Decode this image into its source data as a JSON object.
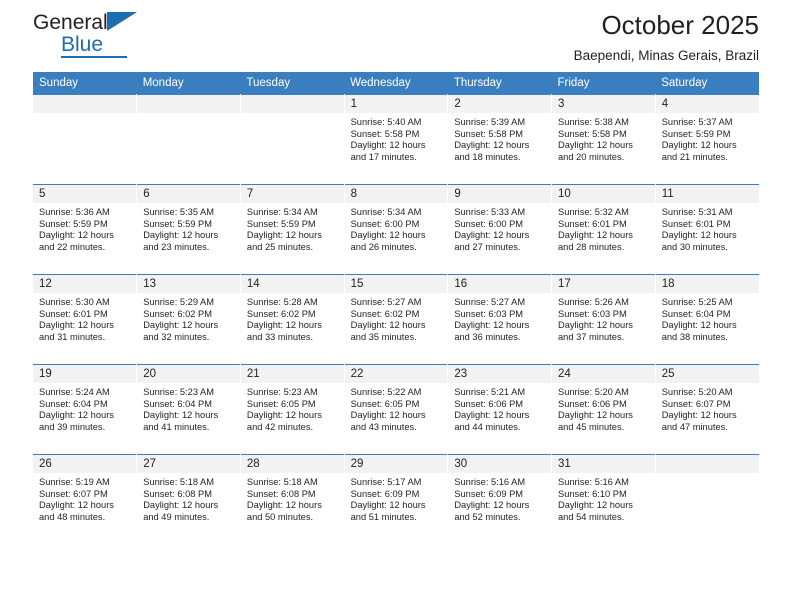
{
  "logo": {
    "word1": "General",
    "word2": "Blue",
    "triangle_color": "#1f6cb4",
    "icon": "general-blue-logo"
  },
  "header": {
    "title": "October 2025",
    "subtitle": "Baependi, Minas Gerais, Brazil"
  },
  "colors": {
    "header_blue": "#3a7ebf",
    "daynum_gray": "#f2f2f2",
    "text": "#231f20"
  },
  "weekdays": [
    "Sunday",
    "Monday",
    "Tuesday",
    "Wednesday",
    "Thursday",
    "Friday",
    "Saturday"
  ],
  "weeks": [
    [
      {
        "day": "",
        "empty": true
      },
      {
        "day": "",
        "empty": true
      },
      {
        "day": "",
        "empty": true
      },
      {
        "day": "1",
        "sunrise": "Sunrise: 5:40 AM",
        "sunset": "Sunset: 5:58 PM",
        "daylight1": "Daylight: 12 hours",
        "daylight2": "and 17 minutes."
      },
      {
        "day": "2",
        "sunrise": "Sunrise: 5:39 AM",
        "sunset": "Sunset: 5:58 PM",
        "daylight1": "Daylight: 12 hours",
        "daylight2": "and 18 minutes."
      },
      {
        "day": "3",
        "sunrise": "Sunrise: 5:38 AM",
        "sunset": "Sunset: 5:58 PM",
        "daylight1": "Daylight: 12 hours",
        "daylight2": "and 20 minutes."
      },
      {
        "day": "4",
        "sunrise": "Sunrise: 5:37 AM",
        "sunset": "Sunset: 5:59 PM",
        "daylight1": "Daylight: 12 hours",
        "daylight2": "and 21 minutes."
      }
    ],
    [
      {
        "day": "5",
        "sunrise": "Sunrise: 5:36 AM",
        "sunset": "Sunset: 5:59 PM",
        "daylight1": "Daylight: 12 hours",
        "daylight2": "and 22 minutes."
      },
      {
        "day": "6",
        "sunrise": "Sunrise: 5:35 AM",
        "sunset": "Sunset: 5:59 PM",
        "daylight1": "Daylight: 12 hours",
        "daylight2": "and 23 minutes."
      },
      {
        "day": "7",
        "sunrise": "Sunrise: 5:34 AM",
        "sunset": "Sunset: 5:59 PM",
        "daylight1": "Daylight: 12 hours",
        "daylight2": "and 25 minutes."
      },
      {
        "day": "8",
        "sunrise": "Sunrise: 5:34 AM",
        "sunset": "Sunset: 6:00 PM",
        "daylight1": "Daylight: 12 hours",
        "daylight2": "and 26 minutes."
      },
      {
        "day": "9",
        "sunrise": "Sunrise: 5:33 AM",
        "sunset": "Sunset: 6:00 PM",
        "daylight1": "Daylight: 12 hours",
        "daylight2": "and 27 minutes."
      },
      {
        "day": "10",
        "sunrise": "Sunrise: 5:32 AM",
        "sunset": "Sunset: 6:01 PM",
        "daylight1": "Daylight: 12 hours",
        "daylight2": "and 28 minutes."
      },
      {
        "day": "11",
        "sunrise": "Sunrise: 5:31 AM",
        "sunset": "Sunset: 6:01 PM",
        "daylight1": "Daylight: 12 hours",
        "daylight2": "and 30 minutes."
      }
    ],
    [
      {
        "day": "12",
        "sunrise": "Sunrise: 5:30 AM",
        "sunset": "Sunset: 6:01 PM",
        "daylight1": "Daylight: 12 hours",
        "daylight2": "and 31 minutes."
      },
      {
        "day": "13",
        "sunrise": "Sunrise: 5:29 AM",
        "sunset": "Sunset: 6:02 PM",
        "daylight1": "Daylight: 12 hours",
        "daylight2": "and 32 minutes."
      },
      {
        "day": "14",
        "sunrise": "Sunrise: 5:28 AM",
        "sunset": "Sunset: 6:02 PM",
        "daylight1": "Daylight: 12 hours",
        "daylight2": "and 33 minutes."
      },
      {
        "day": "15",
        "sunrise": "Sunrise: 5:27 AM",
        "sunset": "Sunset: 6:02 PM",
        "daylight1": "Daylight: 12 hours",
        "daylight2": "and 35 minutes."
      },
      {
        "day": "16",
        "sunrise": "Sunrise: 5:27 AM",
        "sunset": "Sunset: 6:03 PM",
        "daylight1": "Daylight: 12 hours",
        "daylight2": "and 36 minutes."
      },
      {
        "day": "17",
        "sunrise": "Sunrise: 5:26 AM",
        "sunset": "Sunset: 6:03 PM",
        "daylight1": "Daylight: 12 hours",
        "daylight2": "and 37 minutes."
      },
      {
        "day": "18",
        "sunrise": "Sunrise: 5:25 AM",
        "sunset": "Sunset: 6:04 PM",
        "daylight1": "Daylight: 12 hours",
        "daylight2": "and 38 minutes."
      }
    ],
    [
      {
        "day": "19",
        "sunrise": "Sunrise: 5:24 AM",
        "sunset": "Sunset: 6:04 PM",
        "daylight1": "Daylight: 12 hours",
        "daylight2": "and 39 minutes."
      },
      {
        "day": "20",
        "sunrise": "Sunrise: 5:23 AM",
        "sunset": "Sunset: 6:04 PM",
        "daylight1": "Daylight: 12 hours",
        "daylight2": "and 41 minutes."
      },
      {
        "day": "21",
        "sunrise": "Sunrise: 5:23 AM",
        "sunset": "Sunset: 6:05 PM",
        "daylight1": "Daylight: 12 hours",
        "daylight2": "and 42 minutes."
      },
      {
        "day": "22",
        "sunrise": "Sunrise: 5:22 AM",
        "sunset": "Sunset: 6:05 PM",
        "daylight1": "Daylight: 12 hours",
        "daylight2": "and 43 minutes."
      },
      {
        "day": "23",
        "sunrise": "Sunrise: 5:21 AM",
        "sunset": "Sunset: 6:06 PM",
        "daylight1": "Daylight: 12 hours",
        "daylight2": "and 44 minutes."
      },
      {
        "day": "24",
        "sunrise": "Sunrise: 5:20 AM",
        "sunset": "Sunset: 6:06 PM",
        "daylight1": "Daylight: 12 hours",
        "daylight2": "and 45 minutes."
      },
      {
        "day": "25",
        "sunrise": "Sunrise: 5:20 AM",
        "sunset": "Sunset: 6:07 PM",
        "daylight1": "Daylight: 12 hours",
        "daylight2": "and 47 minutes."
      }
    ],
    [
      {
        "day": "26",
        "sunrise": "Sunrise: 5:19 AM",
        "sunset": "Sunset: 6:07 PM",
        "daylight1": "Daylight: 12 hours",
        "daylight2": "and 48 minutes."
      },
      {
        "day": "27",
        "sunrise": "Sunrise: 5:18 AM",
        "sunset": "Sunset: 6:08 PM",
        "daylight1": "Daylight: 12 hours",
        "daylight2": "and 49 minutes."
      },
      {
        "day": "28",
        "sunrise": "Sunrise: 5:18 AM",
        "sunset": "Sunset: 6:08 PM",
        "daylight1": "Daylight: 12 hours",
        "daylight2": "and 50 minutes."
      },
      {
        "day": "29",
        "sunrise": "Sunrise: 5:17 AM",
        "sunset": "Sunset: 6:09 PM",
        "daylight1": "Daylight: 12 hours",
        "daylight2": "and 51 minutes."
      },
      {
        "day": "30",
        "sunrise": "Sunrise: 5:16 AM",
        "sunset": "Sunset: 6:09 PM",
        "daylight1": "Daylight: 12 hours",
        "daylight2": "and 52 minutes."
      },
      {
        "day": "31",
        "sunrise": "Sunrise: 5:16 AM",
        "sunset": "Sunset: 6:10 PM",
        "daylight1": "Daylight: 12 hours",
        "daylight2": "and 54 minutes."
      },
      {
        "day": "",
        "empty": true
      }
    ]
  ]
}
